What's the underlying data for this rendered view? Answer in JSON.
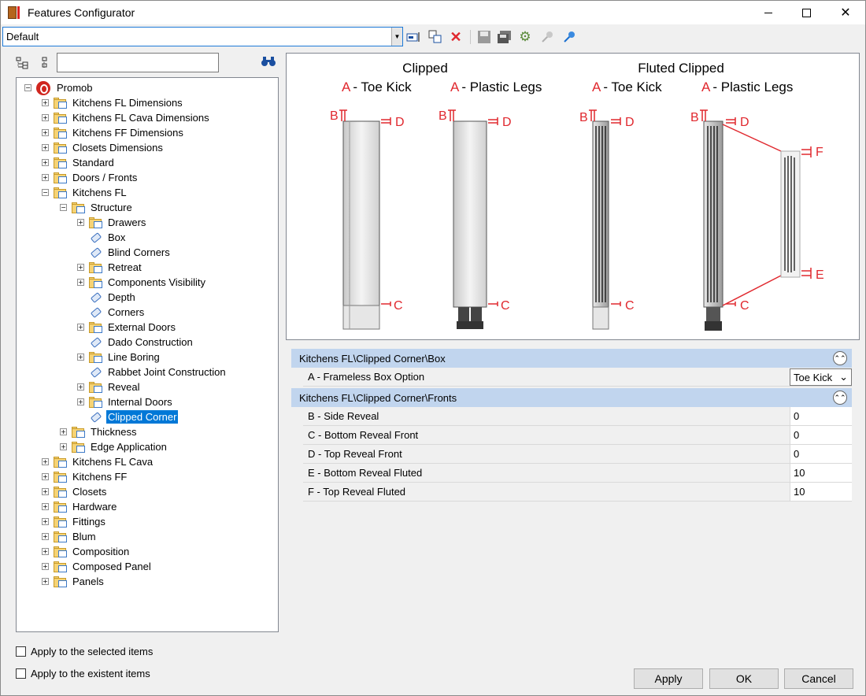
{
  "window": {
    "title": "Features Configurator"
  },
  "toolbar": {
    "preset_value": "Default",
    "icons": [
      "rename-icon",
      "copy-icon",
      "delete-icon",
      "save-icon",
      "save-all-icon",
      "settings-gear-icon",
      "pin-disabled-icon",
      "pin-icon"
    ]
  },
  "tree": {
    "search_value": "",
    "root": "Promob",
    "items": [
      {
        "label": "Kitchens FL Dimensions",
        "kind": "folder",
        "level": 1,
        "expander": "+"
      },
      {
        "label": "Kitchens FL Cava Dimensions",
        "kind": "folder",
        "level": 1,
        "expander": "+"
      },
      {
        "label": "Kitchens FF Dimensions",
        "kind": "folder",
        "level": 1,
        "expander": "+"
      },
      {
        "label": "Closets Dimensions",
        "kind": "folder",
        "level": 1,
        "expander": "+"
      },
      {
        "label": "Standard",
        "kind": "folder",
        "level": 1,
        "expander": "+"
      },
      {
        "label": "Doors / Fronts",
        "kind": "folder",
        "level": 1,
        "expander": "+"
      },
      {
        "label": "Kitchens FL",
        "kind": "folder",
        "level": 1,
        "expander": "-"
      },
      {
        "label": "Structure",
        "kind": "folder",
        "level": 2,
        "expander": "-"
      },
      {
        "label": "Drawers",
        "kind": "folder",
        "level": 3,
        "expander": "+"
      },
      {
        "label": "Box",
        "kind": "tag",
        "level": 3,
        "expander": ""
      },
      {
        "label": "Blind Corners",
        "kind": "tag",
        "level": 3,
        "expander": ""
      },
      {
        "label": "Retreat",
        "kind": "folder",
        "level": 3,
        "expander": "+"
      },
      {
        "label": "Components Visibility",
        "kind": "folder",
        "level": 3,
        "expander": "+"
      },
      {
        "label": "Depth",
        "kind": "tag",
        "level": 3,
        "expander": ""
      },
      {
        "label": "Corners",
        "kind": "tag",
        "level": 3,
        "expander": ""
      },
      {
        "label": "External Doors",
        "kind": "folder",
        "level": 3,
        "expander": "+"
      },
      {
        "label": "Dado Construction",
        "kind": "tag",
        "level": 3,
        "expander": ""
      },
      {
        "label": "Line Boring",
        "kind": "folder",
        "level": 3,
        "expander": "+"
      },
      {
        "label": "Rabbet Joint Construction",
        "kind": "tag",
        "level": 3,
        "expander": ""
      },
      {
        "label": "Reveal",
        "kind": "folder",
        "level": 3,
        "expander": "+"
      },
      {
        "label": "Internal Doors",
        "kind": "folder",
        "level": 3,
        "expander": "+"
      },
      {
        "label": "Clipped Corner",
        "kind": "tag",
        "level": 3,
        "expander": "",
        "selected": true
      },
      {
        "label": "Thickness",
        "kind": "folder",
        "level": 2,
        "expander": "+"
      },
      {
        "label": "Edge Application",
        "kind": "folder",
        "level": 2,
        "expander": "+"
      },
      {
        "label": "Kitchens FL Cava",
        "kind": "folder",
        "level": 1,
        "expander": "+"
      },
      {
        "label": "Kitchens FF",
        "kind": "folder",
        "level": 1,
        "expander": "+"
      },
      {
        "label": "Closets",
        "kind": "folder",
        "level": 1,
        "expander": "+"
      },
      {
        "label": "Hardware",
        "kind": "folder",
        "level": 1,
        "expander": "+"
      },
      {
        "label": "Fittings",
        "kind": "folder",
        "level": 1,
        "expander": "+"
      },
      {
        "label": "Blum",
        "kind": "folder",
        "level": 1,
        "expander": "+"
      },
      {
        "label": "Composition",
        "kind": "folder",
        "level": 1,
        "expander": "+"
      },
      {
        "label": "Composed Panel",
        "kind": "folder",
        "level": 1,
        "expander": "+"
      },
      {
        "label": "Panels",
        "kind": "folder",
        "level": 1,
        "expander": "+"
      }
    ]
  },
  "options": {
    "apply_selected": "Apply to the selected items",
    "apply_existent": "Apply to the existent items"
  },
  "diagram": {
    "title_clipped": "Clipped",
    "title_fluted": "Fluted Clipped",
    "letter_a": "A",
    "sub_toe_kick": "- Toe Kick",
    "sub_plastic_legs": "- Plastic Legs",
    "letter_b": "B",
    "letter_c": "C",
    "letter_d": "D",
    "letter_e": "E",
    "letter_f": "F",
    "accent": "#e0282e"
  },
  "properties": {
    "groups": [
      {
        "title": "Kitchens FL\\Clipped Corner\\Box",
        "rows": [
          {
            "name": "A - Frameless Box Option",
            "value": "Toe Kick",
            "type": "combo"
          }
        ]
      },
      {
        "title": "Kitchens FL\\Clipped Corner\\Fronts",
        "rows": [
          {
            "name": "B - Side Reveal",
            "value": "0",
            "type": "text"
          },
          {
            "name": "C - Bottom Reveal Front",
            "value": "0",
            "type": "text"
          },
          {
            "name": "D - Top Reveal Front",
            "value": "0",
            "type": "text"
          },
          {
            "name": "E - Bottom Reveal Fluted",
            "value": "10",
            "type": "text"
          },
          {
            "name": "F - Top Reveal Fluted",
            "value": "10",
            "type": "text"
          }
        ]
      }
    ]
  },
  "buttons": {
    "apply": "Apply",
    "ok": "OK",
    "cancel": "Cancel"
  }
}
